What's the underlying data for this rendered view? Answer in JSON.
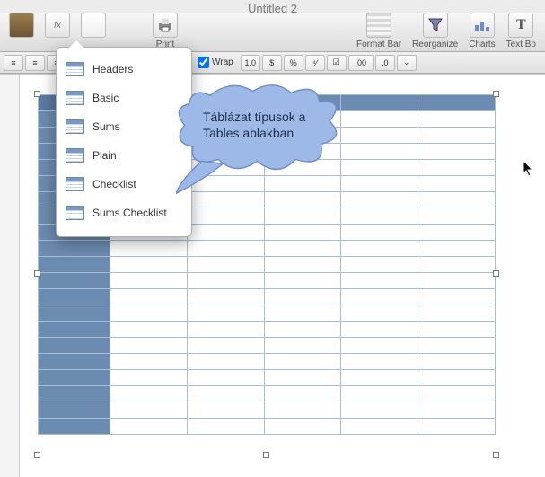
{
  "window": {
    "title": "Untitled 2"
  },
  "toolbar": {
    "items_right": [
      {
        "label": "Format Bar"
      },
      {
        "label": "Reorganize"
      },
      {
        "label": "Charts"
      },
      {
        "label": "Text Bo"
      }
    ],
    "print_label": "Print"
  },
  "format_bar": {
    "wrap_label": "Wrap",
    "num_fmt_1": "1,0",
    "num_fmt_2": ",00",
    "currency": "$",
    "percent": "%",
    "exp": "⁴⁄"
  },
  "tables_menu": {
    "items": [
      {
        "label": "Headers"
      },
      {
        "label": "Basic"
      },
      {
        "label": "Sums"
      },
      {
        "label": "Plain"
      },
      {
        "label": "Checklist"
      },
      {
        "label": "Sums Checklist"
      }
    ]
  },
  "callout": {
    "line1": "Táblázat típusok a",
    "line2": "Tables ablakban"
  }
}
